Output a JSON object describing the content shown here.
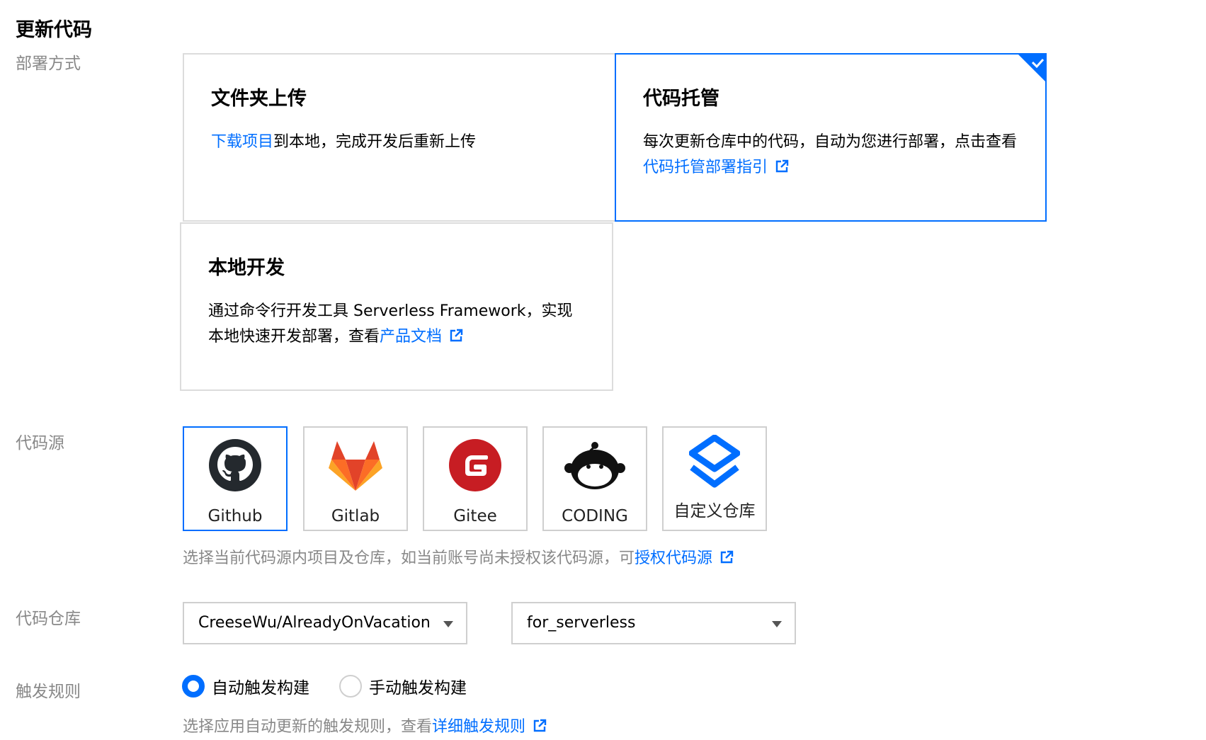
{
  "page_title": "更新代码",
  "deploy": {
    "label": "部署方式",
    "options": [
      {
        "title": "文件夹上传",
        "link": "下载项目",
        "desc": "到本地，完成开发后重新上传"
      },
      {
        "title": "代码托管",
        "desc": "每次更新仓库中的代码，自动为您进行部署，点击查看",
        "link": "代码托管部署指引",
        "selected": true
      },
      {
        "title": "本地开发",
        "desc": "通过命令行开发工具 Serverless Framework，实现本地快速开发部署，查看",
        "link": "产品文档"
      }
    ]
  },
  "source": {
    "label": "代码源",
    "items": [
      {
        "name": "Github",
        "icon": "github-icon",
        "selected": true
      },
      {
        "name": "Gitlab",
        "icon": "gitlab-icon"
      },
      {
        "name": "Gitee",
        "icon": "gitee-icon"
      },
      {
        "name": "CODING",
        "icon": "coding-icon"
      },
      {
        "name": "自定义仓库",
        "icon": "custom-repo-icon"
      }
    ],
    "hint": "选择当前代码源内项目及仓库，如当前账号尚未授权该代码源，可",
    "hint_link": "授权代码源"
  },
  "repo": {
    "label": "代码仓库",
    "repository": "CreeseWu/AlreadyOnVacation",
    "branch": "for_serverless"
  },
  "trigger": {
    "label": "触发规则",
    "options": [
      {
        "label": "自动触发构建",
        "checked": true
      },
      {
        "label": "手动触发构建",
        "checked": false
      }
    ],
    "hint": "选择应用自动更新的触发规则，查看",
    "hint_link": "详细触发规则"
  },
  "colors": {
    "accent": "#006eff",
    "muted": "#888888",
    "border": "#dcdcdc"
  }
}
